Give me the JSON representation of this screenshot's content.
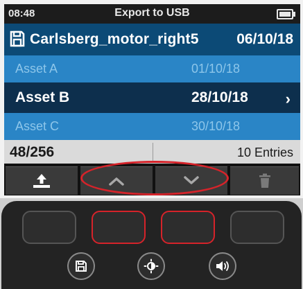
{
  "status": {
    "time": "08:48",
    "title": "Export to USB",
    "battery_icon": "battery-icon"
  },
  "file": {
    "icon": "save-icon",
    "name": "Carlsberg_motor_right5",
    "date": "06/10/18"
  },
  "assets": [
    {
      "label": "Asset A",
      "date": "01/10/18",
      "selected": false
    },
    {
      "label": "Asset B",
      "date": "28/10/18",
      "selected": true,
      "chevron": "›"
    },
    {
      "label": "Asset C",
      "date": "30/10/18",
      "selected": false
    }
  ],
  "footer": {
    "count": "48/256",
    "entries": "10 Entries"
  },
  "softkeys": [
    {
      "icon": "export-icon"
    },
    {
      "icon": "chevron-up-icon"
    },
    {
      "icon": "chevron-down-icon"
    },
    {
      "icon": "trash-icon"
    }
  ],
  "hardware_buttons": [
    {
      "icon": "save-icon"
    },
    {
      "icon": "brightness-icon"
    },
    {
      "icon": "volume-icon"
    }
  ],
  "colors": {
    "file_bar": "#0c4a76",
    "row_dim": "#2a85c6",
    "row_selected": "#0d2f4d",
    "highlight": "#d6232a"
  }
}
